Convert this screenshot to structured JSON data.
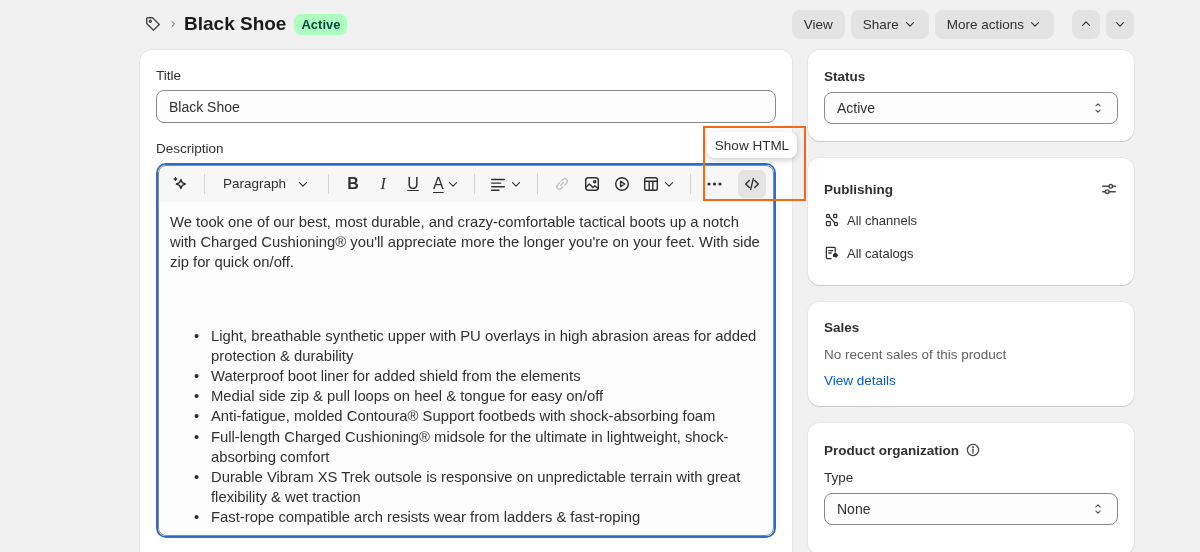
{
  "header": {
    "title": "Black Shoe",
    "status_badge": "Active",
    "actions": [
      {
        "kind": "button",
        "label": "View"
      },
      {
        "kind": "menu",
        "label": "Share"
      },
      {
        "kind": "menu",
        "label": "More actions"
      },
      {
        "kind": "previous"
      },
      {
        "kind": "next"
      }
    ]
  },
  "product": {
    "title_label": "Title",
    "title_value": "Black Shoe",
    "description_label": "Description",
    "toolbar": [
      {
        "kind": "ai"
      },
      {
        "kind": "sep"
      },
      {
        "kind": "format",
        "label": "Paragraph"
      },
      {
        "kind": "sep"
      },
      {
        "kind": "bold",
        "label": "B"
      },
      {
        "kind": "italic",
        "label": "I"
      },
      {
        "kind": "underline",
        "label": "U"
      },
      {
        "kind": "color",
        "label": "A"
      },
      {
        "kind": "sep"
      },
      {
        "kind": "align"
      },
      {
        "kind": "sep"
      },
      {
        "kind": "link",
        "disabled": true
      },
      {
        "kind": "image",
        "disabled": false
      },
      {
        "kind": "video",
        "disabled": false
      },
      {
        "kind": "table",
        "disabled": false
      },
      {
        "kind": "sep"
      },
      {
        "kind": "more"
      },
      {
        "kind": "html",
        "highlighted": true,
        "tooltip": "Show HTML"
      }
    ],
    "description": {
      "paragraph": "We took one of our best, most durable, and crazy-comfortable tactical boots up a notch with Charged Cushioning® you'll appreciate more the longer you're on your feet. With side zip for quick on/off.",
      "marker": "•",
      "bullets": [
        "Light, breathable synthetic upper with PU overlays in high abrasion areas for added protection & durability",
        "Waterproof boot liner for added shield from the elements",
        "Medial side zip & pull loops on heel & tongue for easy on/off",
        "Anti-fatigue, molded Contoura® Support footbeds with shock-absorbing foam",
        "Full-length Charged Cushioning® midsole for the ultimate in lightweight, shock-absorbing comfort",
        "Durable Vibram XS Trek outsole is responsive on unpredictable terrain with great flexibility & wet traction",
        "Fast-rope compatible arch resists wear from ladders & fast-roping"
      ]
    }
  },
  "sidebar": {
    "status": {
      "heading": "Status",
      "value": "Active"
    },
    "publishing": {
      "heading": "Publishing",
      "items": [
        {
          "kind": "channels",
          "label": "All channels"
        },
        {
          "kind": "catalogs",
          "label": "All catalogs"
        }
      ]
    },
    "sales": {
      "heading": "Sales",
      "message": "No recent sales of this product",
      "link": "View details"
    },
    "organization": {
      "heading": "Product organization",
      "type_label": "Type",
      "type_value": "None"
    }
  }
}
